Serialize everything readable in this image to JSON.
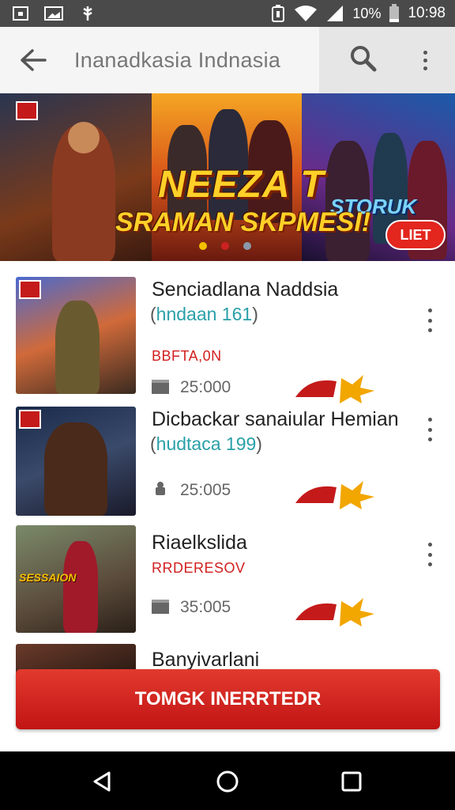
{
  "status_bar": {
    "battery": "10%",
    "time": "10:98",
    "icons": [
      "notification-square-icon",
      "image-icon",
      "usb-icon",
      "battery-saver-icon",
      "wifi-icon",
      "signal-icon",
      "battery-icon"
    ]
  },
  "app_bar": {
    "title": "Inanadkasia Indnasia",
    "icons": [
      "back-arrow-icon",
      "search-icon",
      "more-vert-icon"
    ]
  },
  "banner": {
    "headline": "NEEZA T",
    "subline": "SRAMAN SKPMESI!",
    "logo_text": "STORUK",
    "badge": "LIET",
    "carousel_dots": 3,
    "active_dot": 0
  },
  "items": [
    {
      "title": "Senciadlana Naddsia",
      "subtitle": "hndaan 161",
      "tag": "BBFTA,0N",
      "stat": "25:000",
      "stat_icon": "film-icon"
    },
    {
      "title": "Dicbackar sanaiular Hemian",
      "subtitle": "hudtaca 199",
      "tag": "",
      "stat": "25:005",
      "stat_icon": "lock-icon"
    },
    {
      "title": "Riaelkslida",
      "subtitle": "",
      "tag": "RRDERESOV",
      "stat": "35:005",
      "stat_icon": "film-icon",
      "thumb_text": "SESSAION"
    },
    {
      "title": "Banyivarlani",
      "subtitle": "",
      "tag": "",
      "stat": "",
      "stat_icon": ""
    }
  ],
  "cta_button": {
    "label": "TOMGK INERRTEDR"
  },
  "nav_bar": {
    "icons": [
      "back-triangle-icon",
      "home-circle-icon",
      "recents-square-icon"
    ]
  },
  "colors": {
    "accent": "#d21f1f",
    "teal": "#2aa0a8",
    "status_bar": "#4a4a4a",
    "app_bar": "#f5f5f5"
  }
}
